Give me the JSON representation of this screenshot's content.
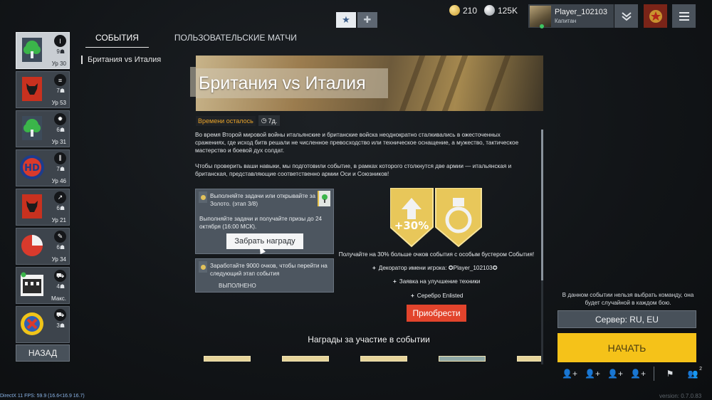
{
  "top_bar": {
    "mode_tabs": [
      {
        "icon": "star-icon",
        "active": true
      },
      {
        "icon": "cross-icon",
        "active": false
      }
    ],
    "gold": "210",
    "silver": "125K",
    "player": {
      "name": "Player_102103",
      "rank": "Капитан"
    },
    "menu_icon": "hamburger-icon"
  },
  "sidebar": {
    "slots": [
      {
        "count": "9",
        "level": "Ур 30",
        "emblem": "tree",
        "badge": "I",
        "active": true
      },
      {
        "count": "7",
        "level": "Ур 53",
        "emblem": "bull",
        "badge": "≡",
        "active": false
      },
      {
        "count": "6",
        "level": "Ур 31",
        "emblem": "tree",
        "badge": "✹",
        "active": false
      },
      {
        "count": "7",
        "level": "Ур 46",
        "emblem": "hd",
        "badge": "⫼",
        "active": false
      },
      {
        "count": "6",
        "level": "Ур 21",
        "emblem": "bull",
        "badge": "↗",
        "active": false
      },
      {
        "count": "6",
        "level": "Ур 34",
        "emblem": "pie",
        "badge": "✎",
        "active": false
      },
      {
        "count": "4",
        "level": "Макс.",
        "emblem": "castle",
        "badge": "⛟",
        "active": false
      },
      {
        "count": "3",
        "level": "",
        "emblem": "shield",
        "badge": "⛟",
        "active": false
      }
    ],
    "back_label": "НАЗАД"
  },
  "tabs": {
    "events": "СОБЫТИЯ",
    "custom": "ПОЛЬЗОВАТЕЛЬСКИЕ МАТЧИ"
  },
  "event_list": [
    "Британия vs Италия"
  ],
  "event": {
    "title": "Британия vs Италия",
    "time_left_label": "Времени осталось",
    "time_left_value": "7д.",
    "description": [
      "Во время Второй мировой войны итальянские и британские войска неоднократно сталкивались в ожесточенных сражениях, где исход битв решали не численное превосходство или техническое оснащение, а мужество, тактическое мастерство и боевой дух солдат.",
      "Чтобы проверить ваши навыки, мы подготовили событие, в рамках которого столкнутся две армии — итальянская и британская, представляющие соответственно армии Оси и Союзников!"
    ],
    "task1": {
      "main": "Выполняйте задачи или открывайте за Золото. (этап 3/8)",
      "sub": "Выполняйте задачи и получайте призы до 24 октября (16:00 МСК).",
      "claim": "Забрать награду"
    },
    "task2": {
      "main": "Заработайте 9000 очков, чтобы перейти на следующий этап события",
      "status": "ВЫПОЛНЕНО"
    },
    "booster": {
      "badge": "+30%",
      "text": "Получайте на 30% больше очков события с особым бустером События!",
      "perks": [
        "Декоратор имени игрока: ✪Player_102103✪",
        "Заявка на улучшение техники",
        "Серебро Enlisted"
      ],
      "buy": "Приобрести"
    },
    "rewards_title": "Награды за участие в событии"
  },
  "right_panel": {
    "note": "В данном событии нельзя выбрать команду, она будет случайной в каждом бою.",
    "server": "Сервер: RU, EU",
    "start": "НАЧАТЬ",
    "squad_count": "2"
  },
  "footer": {
    "fps": "DirectX 11 FPS: 59.9 (16.6<16.9 16.7)",
    "version": "version: 0.7.0.83"
  },
  "colors": {
    "accent_yellow": "#f5c219",
    "buy_red": "#e2442c",
    "timer_orange": "#e8a32a"
  }
}
